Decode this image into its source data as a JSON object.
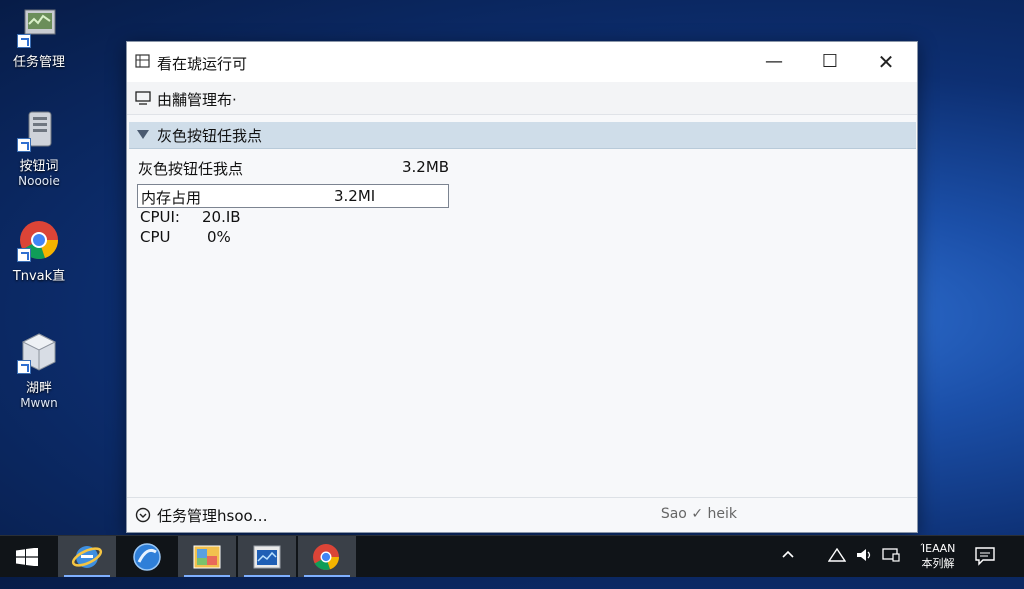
{
  "desktop": {
    "icons": [
      {
        "label": "任务管理",
        "sub": ""
      },
      {
        "label": "按钮词",
        "sub": "Noooie"
      },
      {
        "label": "Tnvak直",
        "sub": ""
      },
      {
        "label": "湖畔",
        "sub": "Mwwn"
      }
    ]
  },
  "window": {
    "title": "看在琥运行可",
    "controls": {
      "minimize": "—",
      "maximize": "☐",
      "close": "✕"
    },
    "toolbar_label": "由黼管理布·",
    "group": {
      "label": "灰色按钮任我点"
    },
    "process": {
      "name": "灰色按钮任我点",
      "memory": "3.2MB"
    },
    "memory_row": {
      "label": "内存占用",
      "value": "3.2MI"
    },
    "cpu_rows": [
      {
        "label": "CPUI:",
        "value": "20.IB"
      },
      {
        "label": "CPU",
        "value": "0%"
      }
    ],
    "footer": {
      "fewer_details": "任务管理hsoo…",
      "end_task": "Sao ✓ heik"
    }
  },
  "taskbar": {
    "tray_text_line1": "ΊΕΑΑΝ",
    "tray_text_line2": "本列解"
  }
}
